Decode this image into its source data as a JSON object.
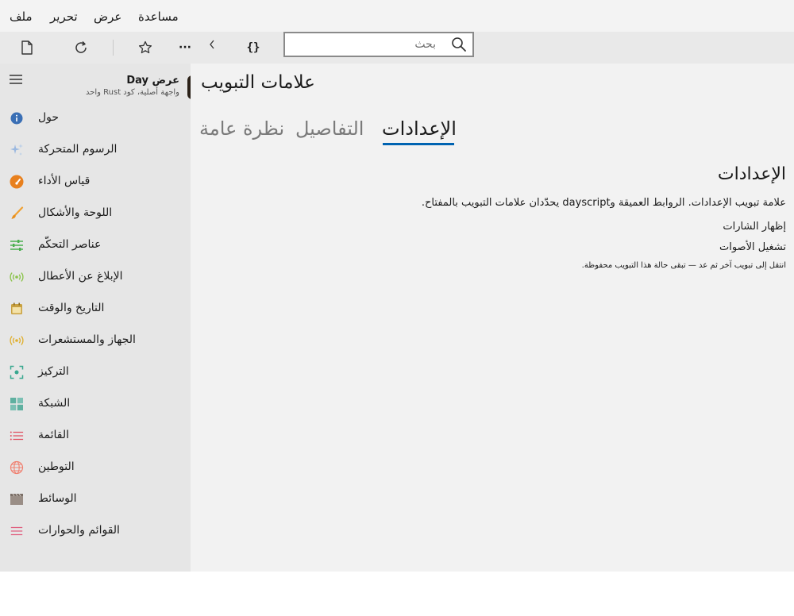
{
  "menu": {
    "file": "ملف",
    "edit": "تحرير",
    "view": "عرض",
    "help": "مساعدة"
  },
  "toolbar": {
    "icons": [
      "new-document-icon",
      "refresh-icon",
      "star-icon",
      "more-icon",
      "chevron-icon",
      "braces-icon"
    ],
    "more_label": "···",
    "braces_label": "{}",
    "search_placeholder": "بحث"
  },
  "sidebar": {
    "app_title": "عرض Day",
    "app_subtitle": "واجهة أصلية، كود Rust واحد",
    "items": [
      {
        "label": "حول",
        "icon": "info-icon",
        "color": "#3a6fb5"
      },
      {
        "label": "الرسوم المتحركة",
        "icon": "sparkle-icon",
        "color": "#9ab8e0"
      },
      {
        "label": "قياس الأداء",
        "icon": "gauge-icon",
        "color": "#e8801e"
      },
      {
        "label": "اللوحة والأشكال",
        "icon": "brush-icon",
        "color": "#f0a030"
      },
      {
        "label": "عناصر التحكّم",
        "icon": "sliders-icon",
        "color": "#4caf50"
      },
      {
        "label": "الإبلاغ عن الأعطال",
        "icon": "broadcast-icon",
        "color": "#8bc34a"
      },
      {
        "label": "التاريخ والوقت",
        "icon": "calendar-icon",
        "color": "#c8a040"
      },
      {
        "label": "الجهاز والمستشعرات",
        "icon": "sensor-icon",
        "color": "#e0b030"
      },
      {
        "label": "التركيز",
        "icon": "focus-icon",
        "color": "#3aa890"
      },
      {
        "label": "الشبكة",
        "icon": "grid-icon",
        "color": "#5fb0a0"
      },
      {
        "label": "القائمة",
        "icon": "list-icon",
        "color": "#e05060"
      },
      {
        "label": "التوطين",
        "icon": "globe-icon",
        "color": "#f08070"
      },
      {
        "label": "الوسائط",
        "icon": "media-icon",
        "color": "#9a8e86"
      },
      {
        "label": "القوائم والحوارات",
        "icon": "menu-lines-icon",
        "color": "#e06080"
      }
    ]
  },
  "content": {
    "title": "علامات التبويب",
    "tabs": [
      "الإعدادات",
      "التفاصيل",
      "نظرة عامة"
    ],
    "active_tab": "الإعدادات",
    "accent": "#0063b1",
    "section_heading": "الإعدادات",
    "description": "علامة تبويب الإعدادات. الروابط العميقة وdayscript يحدّدان علامات التبويب بالمفتاح.",
    "options": [
      "إظهار الشارات",
      "تشغيل الأصوات"
    ],
    "note": "انتقل إلى تبويب آخر ثم عد — تبقى حالة هذا التبويب محفوظة."
  }
}
